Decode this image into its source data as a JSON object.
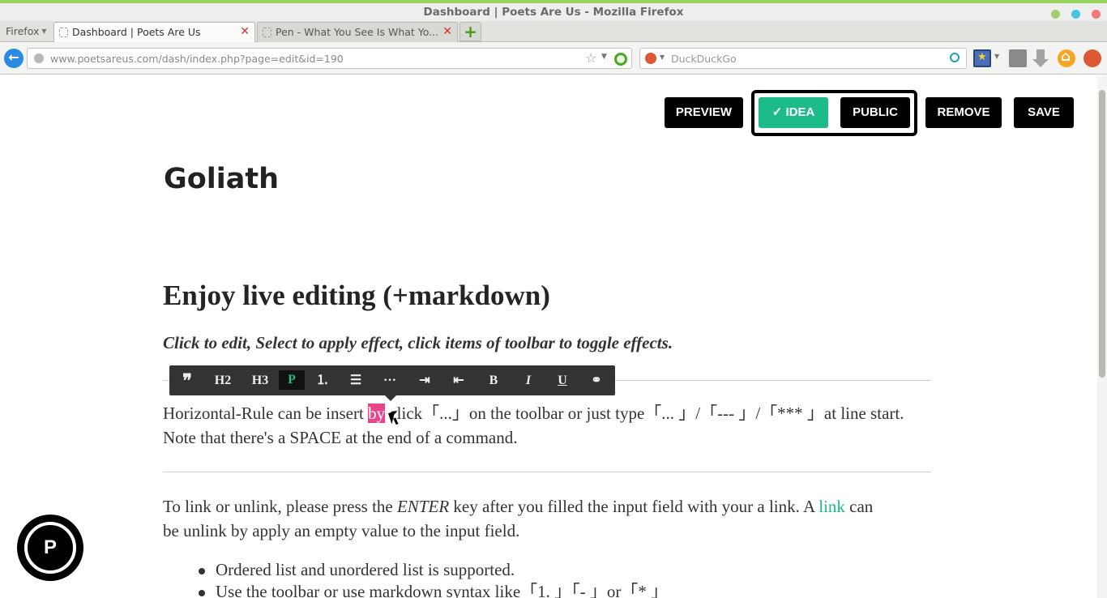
{
  "window": {
    "title": "Dashboard | Poets Are Us - Mozilla Firefox"
  },
  "browser": {
    "menu_label": "Firefox",
    "tabs": [
      {
        "label": "Dashboard | Poets Are Us",
        "active": true
      },
      {
        "label": "Pen - What You See Is What Yo...",
        "active": false
      }
    ],
    "new_tab_label": "+",
    "back_label": "←",
    "url": "www.poetsareus.com/dash/index.php?page=edit&id=190",
    "search_placeholder": "DuckDuckGo"
  },
  "actions": {
    "preview": "PREVIEW",
    "idea": "✓ IDEA",
    "public": "PUBLIC",
    "remove": "REMOVE",
    "save": "SAVE"
  },
  "document": {
    "title": "Goliath",
    "heading": "Enjoy live editing (+markdown)",
    "subtitle": "Click to edit, Select to apply effect, click items of toolbar to toggle effects.",
    "para1_line1_before": "Horizontal-Rule can be insert ",
    "para1_highlight": "by",
    "para1_line1_after": " click「...」on the toolbar or just type「... 」/「--- 」/「*** 」at line start.",
    "para1_line2": "Note that there's a SPACE at the end of a command.",
    "para2_line1_before": "To link or unlink, please press the ",
    "para2_enter": "ENTER",
    "para2_line1_mid": " key after you filled the input field with your a link. A ",
    "para2_link": "link",
    "para2_line1_after": " can",
    "para2_line2": "be unlink by apply an empty value to the input field.",
    "list": [
      "Ordered list and unordered list is supported.",
      "Use the toolbar or use markdown syntax like「1. 」「- 」or「* 」"
    ]
  },
  "editor_toolbar": {
    "blockquote": "❞",
    "h2": "H2",
    "h3": "H3",
    "p": "P",
    "ordered_list": "⒈",
    "unordered_list": "☰",
    "hr": "···",
    "indent": "⇥",
    "outdent": "⇤",
    "bold": "B",
    "italic": "I",
    "underline": "U",
    "link": "⚭"
  },
  "fab": {
    "label": "P"
  },
  "colors": {
    "accent": "#1dba8a",
    "highlight": "#e8458b",
    "button_bg": "#000000",
    "toolbar_bg": "#333333"
  }
}
